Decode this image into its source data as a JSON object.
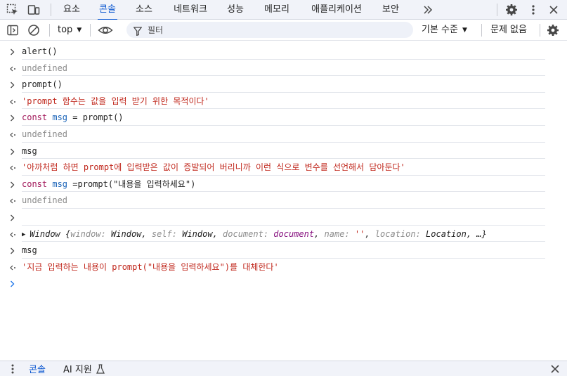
{
  "tabs": [
    "요소",
    "콘솔",
    "소스",
    "네트워크",
    "성능",
    "메모리",
    "애플리케이션",
    "보안"
  ],
  "active_tab": "콘솔",
  "more_tabs_icon": "chevrons-right-icon",
  "toolbar": {
    "context": "top",
    "filter_placeholder": "필터",
    "levels": "기본 수준",
    "issues": "문제 없음"
  },
  "console": [
    {
      "kind": "input",
      "text": "alert()"
    },
    {
      "kind": "output",
      "style": "undefined",
      "text": "undefined"
    },
    {
      "kind": "input",
      "text": "prompt()"
    },
    {
      "kind": "output",
      "style": "string",
      "text": "'prompt 함수는 값을 입력 받기 위한 목적이다'"
    },
    {
      "kind": "input",
      "text": "const msg = prompt()"
    },
    {
      "kind": "output",
      "style": "undefined",
      "text": "undefined"
    },
    {
      "kind": "input",
      "text": "msg"
    },
    {
      "kind": "output",
      "style": "string",
      "text": "'아까처럼 하면 prompt에 입력받은 값이 증발되어 버리니까 이런 식으로 변수를 선언해서 담아둔다'"
    },
    {
      "kind": "input",
      "text": "const msg =prompt(\"내용을 입력하세요\")"
    },
    {
      "kind": "output",
      "style": "undefined",
      "text": "undefined"
    },
    {
      "kind": "input",
      "text": ""
    },
    {
      "kind": "output",
      "style": "object",
      "text": "Window {window: Window, self: Window, document: document, name: '', location: Location, …}"
    },
    {
      "kind": "input",
      "text": "msg"
    },
    {
      "kind": "output",
      "style": "string",
      "text": "'지금 입력하는 내용이 prompt(\"내용을 입력하세요\")를 대체한다'"
    }
  ],
  "object_preview": {
    "name": "Window",
    "props": [
      {
        "key": "window",
        "value": "Window",
        "style": "plain"
      },
      {
        "key": "self",
        "value": "Window",
        "style": "plain"
      },
      {
        "key": "document",
        "value": "document",
        "style": "doc"
      },
      {
        "key": "name",
        "value": "''",
        "style": "str"
      },
      {
        "key": "location",
        "value": "Location",
        "style": "plain"
      }
    ],
    "ellipsis": "…"
  },
  "drawer": {
    "tabs": [
      "콘솔",
      "AI 지원"
    ],
    "active": "콘솔"
  },
  "colors": {
    "accent": "#0b57d0",
    "string": "#c0271c",
    "undefined": "#8d8d8d",
    "keyword": "#a2185a",
    "variable": "#1a63b8"
  }
}
